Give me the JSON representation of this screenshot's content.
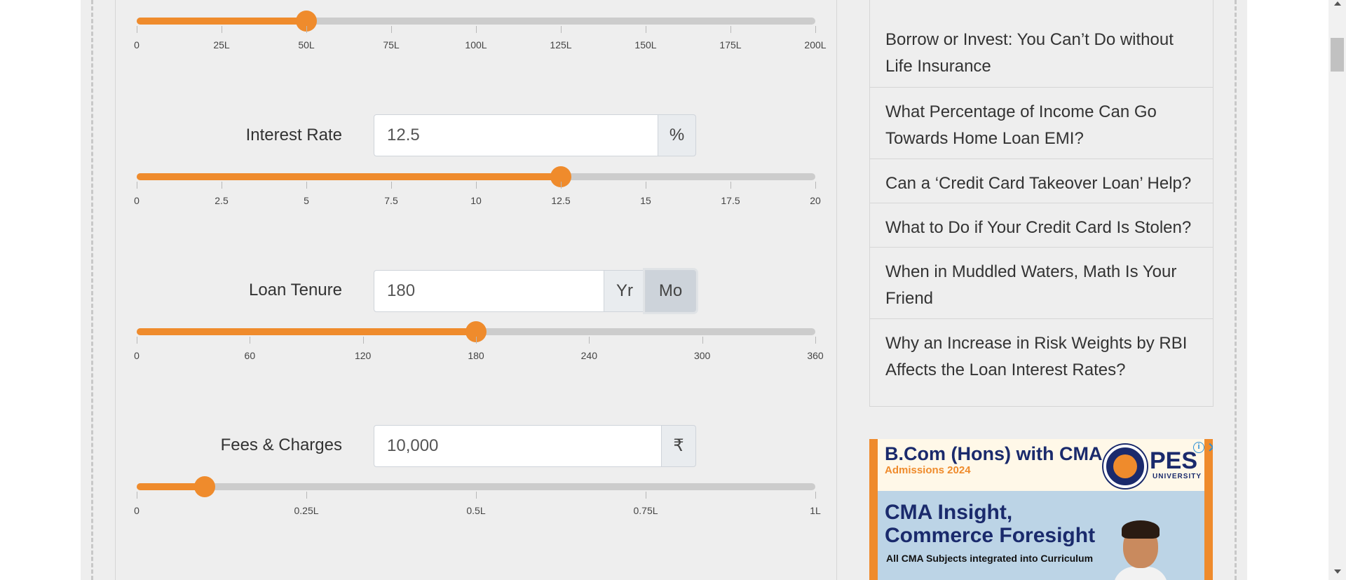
{
  "calculator": {
    "principal": {
      "slider_fraction": 0.25,
      "ticks": [
        "0",
        "25L",
        "50L",
        "75L",
        "100L",
        "125L",
        "150L",
        "175L",
        "200L"
      ]
    },
    "interest": {
      "label": "Interest Rate",
      "value": "12.5",
      "unit": "%",
      "slider_fraction": 0.625,
      "ticks": [
        "0",
        "2.5",
        "5",
        "7.5",
        "10",
        "12.5",
        "15",
        "17.5",
        "20"
      ]
    },
    "tenure": {
      "label": "Loan Tenure",
      "value": "180",
      "unit_year": "Yr",
      "unit_month": "Mo",
      "selected_unit": "Mo",
      "slider_fraction": 0.5,
      "ticks": [
        "0",
        "60",
        "120",
        "180",
        "240",
        "300",
        "360"
      ]
    },
    "fees": {
      "label": "Fees & Charges",
      "value": "10,000",
      "unit": "₹",
      "slider_fraction": 0.1,
      "ticks": [
        "0",
        "0.25L",
        "0.5L",
        "0.75L",
        "1L"
      ]
    }
  },
  "related_articles": [
    "Borrow or Invest: You Can’t Do without Life Insurance",
    "What Percentage of Income Can Go Towards Home Loan EMI?",
    "Can a ‘Credit Card Takeover Loan’ Help?",
    "What to Do if Your Credit Card Is Stolen?",
    "When in Muddled Waters, Math Is Your Friend",
    "Why an Increase in Risk Weights by RBI Affects the Loan Interest Rates?"
  ],
  "ad": {
    "headline": "B.Com (Hons) with CMA",
    "subhead": "Admissions 2024",
    "brand": "PES",
    "brand_sub": "UNIVERSITY",
    "big_line1": "CMA Insight,",
    "big_line2": "Commerce Foresight",
    "small": "All CMA Subjects integrated into Curriculum",
    "info_icon": "i",
    "close_icon": "✕"
  },
  "colors": {
    "accent": "#ef8b2c",
    "track": "#cccccc",
    "page_bg": "#eeeeee"
  }
}
